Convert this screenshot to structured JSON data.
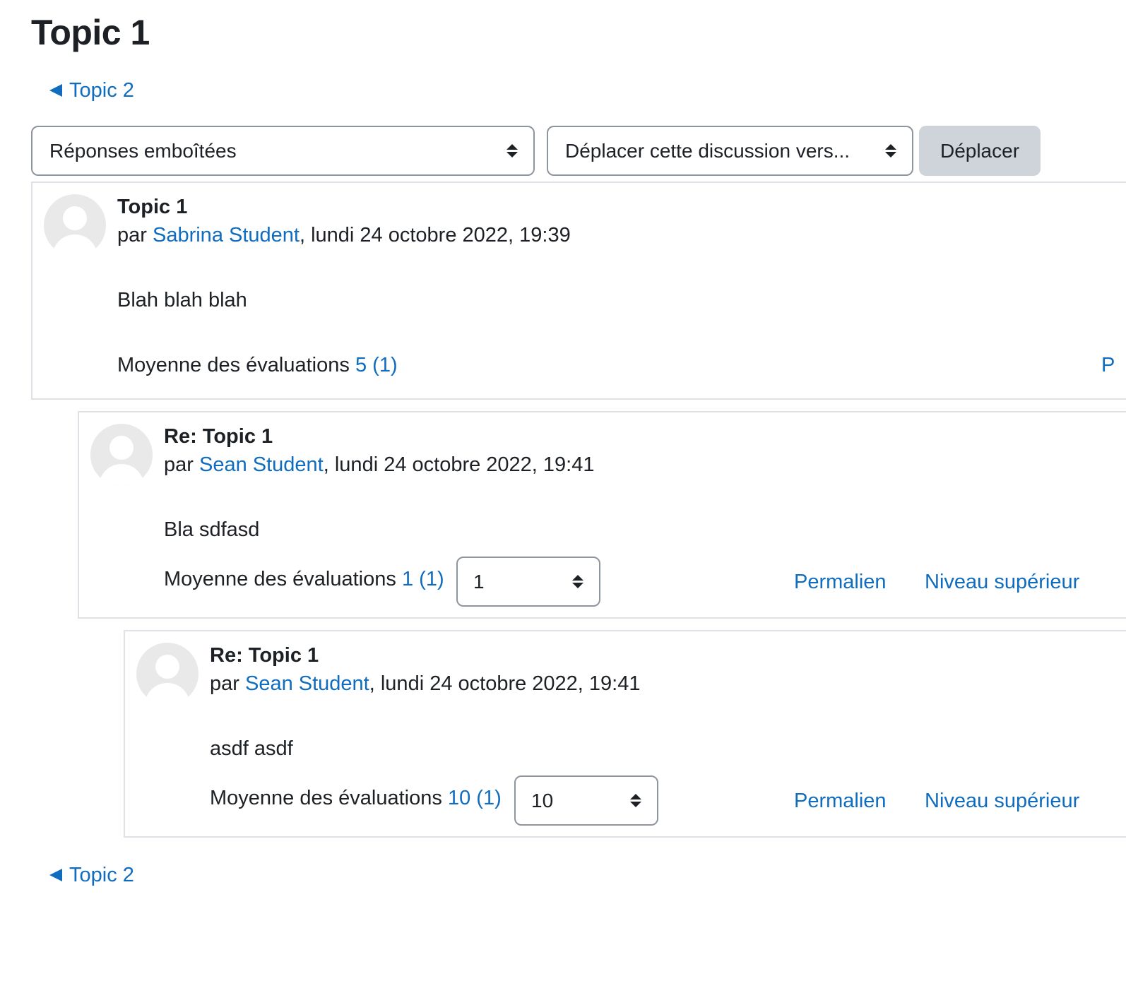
{
  "page": {
    "title": "Topic 1"
  },
  "navigation": {
    "prev_label": "Topic 2"
  },
  "controls": {
    "display_mode": "Réponses emboîtées",
    "move_placeholder": "Déplacer cette discussion vers...",
    "move_button": "Déplacer"
  },
  "posts": [
    {
      "subject": "Topic 1",
      "by": "par",
      "author": "Sabrina Student",
      "date": ", lundi 24 octobre 2022, 19:39",
      "content": "Blah blah blah",
      "rating_label": "Moyenne des évaluations",
      "rating_avg": "5",
      "rating_count": "(1)",
      "cut_link": "P"
    },
    {
      "subject": "Re: Topic 1",
      "by": "par",
      "author": "Sean Student",
      "date": ", lundi 24 octobre 2022, 19:41",
      "content": "Bla sdfasd",
      "rating_label": "Moyenne des évaluations",
      "rating_avg": "1",
      "rating_count": "(1)",
      "rating_value": "1",
      "permalink": "Permalien",
      "parent": "Niveau supérieur"
    },
    {
      "subject": "Re: Topic 1",
      "by": "par",
      "author": "Sean Student",
      "date": ", lundi 24 octobre 2022, 19:41",
      "content": "asdf asdf",
      "rating_label": "Moyenne des évaluations",
      "rating_avg": "10",
      "rating_count": "(1)",
      "rating_value": "10",
      "permalink": "Permalien",
      "parent": "Niveau supérieur"
    }
  ],
  "colors": {
    "link": "#0f6cbf",
    "text": "#1d2125",
    "border": "#dee2e6",
    "button_bg": "#ced4da"
  },
  "icons": {
    "nav_prev": "triangle-left-icon",
    "select_arrows": "updown-chevron-icon",
    "avatar": "default-user-avatar-icon"
  }
}
